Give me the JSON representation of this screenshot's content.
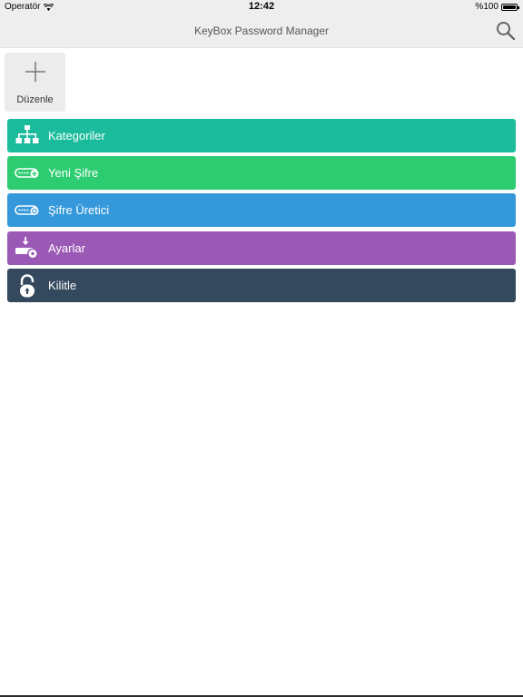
{
  "status_bar": {
    "carrier": "Operatör",
    "time": "12:42",
    "battery": "%100"
  },
  "nav": {
    "title": "KeyBox Password Manager",
    "search_icon": "search-icon"
  },
  "edit_tile": {
    "label": "Düzenle",
    "icon": "plus-icon"
  },
  "menu": [
    {
      "label": "Kategoriler",
      "icon": "hierarchy-icon",
      "color": "#1abc9c"
    },
    {
      "label": "Yeni Şifre",
      "icon": "password-add-icon",
      "color": "#2ecc71"
    },
    {
      "label": "Şifre Üretici",
      "icon": "password-generator-icon",
      "color": "#3498db"
    },
    {
      "label": "Ayarlar",
      "icon": "settings-icon",
      "color": "#9b59b6"
    },
    {
      "label": "Kilitle",
      "icon": "lock-icon",
      "color": "#34495e"
    }
  ]
}
